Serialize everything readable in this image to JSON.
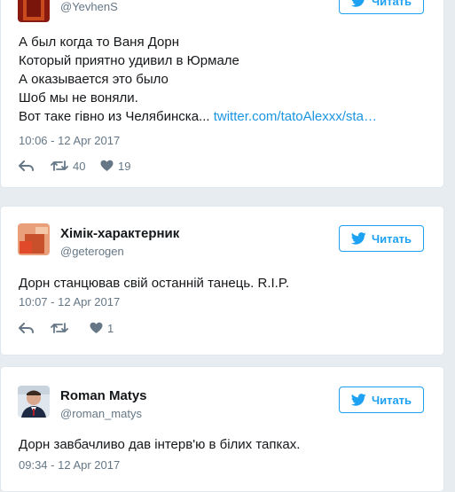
{
  "tweets": [
    {
      "name": "",
      "handle": "@YevhenS",
      "follow_label": "Читать",
      "text_lines": [
        "А был когда то Ваня Дорн",
        "Который приятно удивил в Юрмале",
        "А оказывается это было",
        "Шоб мы не воняли.",
        "Вот таке гівно из Челябинска... "
      ],
      "link": "twitter.com/tatoAlexxx/sta…",
      "date": "10:06 - 12 Apr 2017",
      "retweets": "40",
      "likes": "19"
    },
    {
      "name": "Хімік-характерник",
      "handle": "@geterogen",
      "follow_label": "Читать",
      "text_lines": [
        "Дорн станцював свій останній танець. R.I.P."
      ],
      "date": "10:07 - 12 Apr 2017",
      "retweets": "",
      "likes": "1"
    },
    {
      "name": "Roman Matys",
      "handle": "@roman_matys",
      "follow_label": "Читать",
      "text_lines": [
        "Дорн завбачливо дав інтерв'ю в білих тапках."
      ],
      "date": "09:34 - 12 Apr 2017"
    }
  ],
  "colors": {
    "brand": "#1da1f2",
    "link": "#1b95e0",
    "muted": "#657786",
    "background": "#e6ecf0"
  },
  "icons": {
    "follow": "twitter-bird-icon",
    "reply": "reply-icon",
    "retweet": "retweet-icon",
    "like": "heart-icon"
  }
}
